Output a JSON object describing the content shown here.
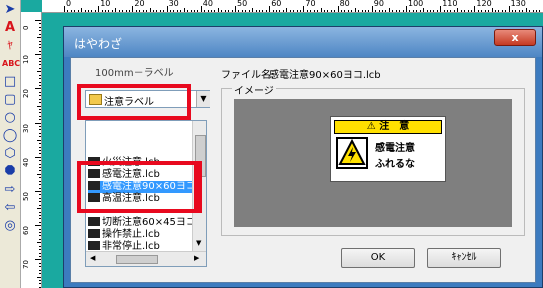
{
  "ruler": {
    "top_numbers": [
      "0",
      "10",
      "20",
      "30",
      "40",
      "50",
      "60",
      "70",
      "80",
      "90",
      "100",
      "110",
      "120",
      "130",
      "140"
    ],
    "left_numbers": [
      "0",
      "10",
      "20",
      "30",
      "40",
      "50",
      "60",
      "70"
    ]
  },
  "toolbar": {
    "icons": [
      "pointer-icon",
      "text-icon",
      "rotated-text-icon",
      "abc-text-icon",
      "rectangle-icon",
      "rounded-rectangle-icon",
      "ellipse-icon",
      "circle-icon",
      "hexagon-icon",
      "octagon-icon",
      "arrow-right-icon",
      "arrow-left-icon",
      "circle-outline-icon"
    ]
  },
  "dialog": {
    "title": "はやわざ",
    "close": "x",
    "size_label": "100mm－ラベル",
    "category": "注意ラベル",
    "file_name_label": "ファイル名:",
    "file_name": "感電注意90×60ヨコ.lcb",
    "preview_label": "イメージ",
    "preview": {
      "header": "注　意",
      "line1": "感電注意",
      "line2": "ふれるな"
    },
    "files": [
      "火災注意.lcb",
      "感電注意.lcb",
      "感電注意90×60ヨコ",
      "高温注意.lcb",
      "",
      "切断注意60×45ヨコ",
      "操作禁止.lcb",
      "非常停止.lcb"
    ],
    "selected_index": 2,
    "ok": "OK",
    "cancel": "ｷｬﾝｾﾙ"
  },
  "colors": {
    "accent_red": "#e8091e",
    "selection": "#3399ff",
    "warning_yellow": "#ffe000"
  }
}
